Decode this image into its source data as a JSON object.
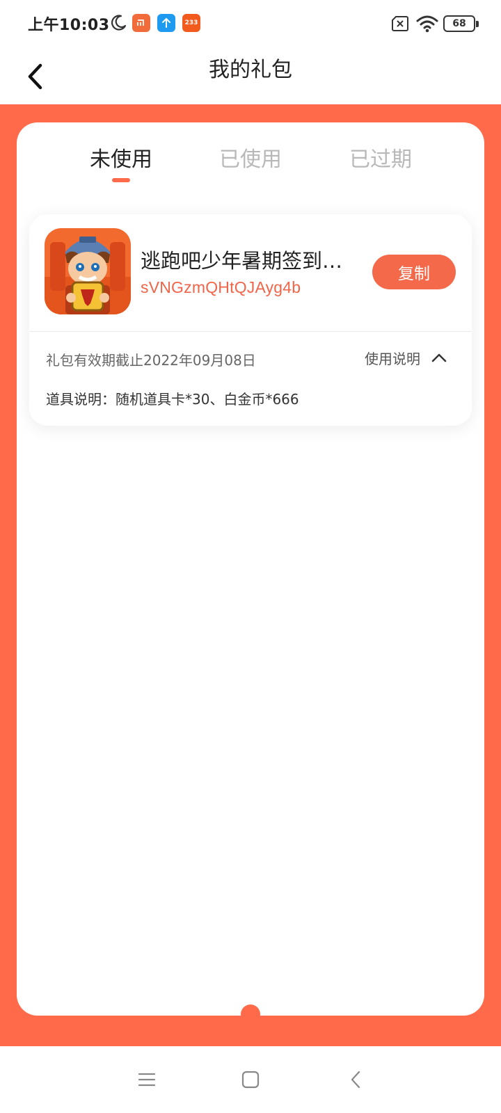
{
  "status_bar": {
    "time": "上午10:03",
    "battery": "68",
    "app_icons": [
      "mi-app-icon",
      "upload-app-icon",
      "233-app-icon"
    ],
    "app3_label": "233"
  },
  "header": {
    "title": "我的礼包",
    "back_icon": "chevron-left-icon"
  },
  "tabs": [
    {
      "label": "未使用",
      "active": true
    },
    {
      "label": "已使用",
      "active": false
    },
    {
      "label": "已过期",
      "active": false
    }
  ],
  "gifts": [
    {
      "game_name": "逃跑吧少年暑期签到礼包",
      "code": "sVNGzmQHtQJAyg4b",
      "copy_label": "复制",
      "expiry": "礼包有效期截止2022年09月08日",
      "usage_label": "使用说明",
      "props_desc": "道具说明：随机道具卡*30、白金币*666"
    }
  ],
  "nav_bar": {
    "icons": [
      "menu-icon",
      "home-icon",
      "back-icon"
    ]
  },
  "colors": {
    "accent": "#ff6b4a",
    "code_text": "#f0654a",
    "inactive_tab": "#b8b8b8"
  }
}
